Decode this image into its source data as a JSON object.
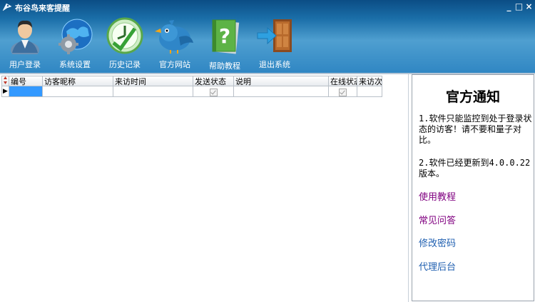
{
  "window": {
    "title": "布谷鸟来客提醒",
    "controls": {
      "minimize": "_",
      "maximize": "□",
      "close": "×"
    }
  },
  "toolbar": {
    "items": [
      {
        "label": "用户登录",
        "icon": "user-login-icon"
      },
      {
        "label": "系统设置",
        "icon": "settings-globe-gear-icon"
      },
      {
        "label": "历史记录",
        "icon": "history-clock-icon"
      },
      {
        "label": "官方网站",
        "icon": "bird-website-icon"
      },
      {
        "label": "帮助教程",
        "icon": "help-book-icon"
      },
      {
        "label": "退出系统",
        "icon": "exit-door-icon"
      }
    ]
  },
  "grid": {
    "row_indicator": "▶",
    "columns": [
      "编号",
      "访客昵称",
      "来访时间",
      "发送状态",
      "说明",
      "在线状态",
      "来访次"
    ],
    "rows": [
      {
        "cells": [
          "",
          "",
          "",
          "checkbox-disabled",
          "",
          "checkbox-disabled",
          ""
        ]
      }
    ]
  },
  "notice": {
    "title": "官方通知",
    "paragraph1": "1.软件只能监控到处于登录状态的访客！请不要和量子对比。",
    "paragraph2": "2.软件已经更新到4.0.0.22版本。",
    "links": [
      "使用教程",
      "常见问答",
      "修改密码",
      "代理后台"
    ],
    "colors": {
      "visited_link": "#800080",
      "link": "#1f5fb0"
    }
  },
  "colors": {
    "title_band": "#1a6ea8",
    "selection": "#3399ff"
  }
}
